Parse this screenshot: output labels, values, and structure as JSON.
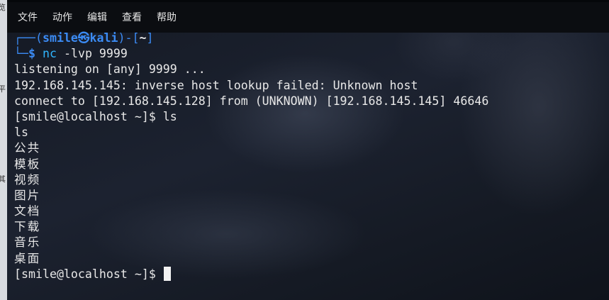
{
  "left_strip": {
    "chars": [
      "览",
      "平",
      "其"
    ]
  },
  "menu": [
    {
      "id": "file",
      "label": "文件"
    },
    {
      "id": "action",
      "label": "动作"
    },
    {
      "id": "edit",
      "label": "编辑"
    },
    {
      "id": "view",
      "label": "查看"
    },
    {
      "id": "help",
      "label": "帮助"
    }
  ],
  "prompt": {
    "corner_top": "┌──(",
    "user": "smile",
    "at_symbol": "㉿",
    "host": "kali",
    "close_paren": ")-[",
    "dir": "~",
    "close_bracket": "]",
    "corner_bottom": "└─",
    "dollar": "$",
    "command_name": "nc",
    "command_args": "-lvp 9999"
  },
  "output_lines": [
    "listening on [any] 9999 ...",
    "192.168.145.145: inverse host lookup failed: Unknown host",
    "connect to [192.168.145.128] from (UNKNOWN) [192.168.145.145] 46646",
    "[smile@localhost ~]$ ls",
    "ls"
  ],
  "ls_entries": [
    "公共",
    "模板",
    "视频",
    "图片",
    "文档",
    "下载",
    "音乐",
    "桌面"
  ],
  "remote_prompt": "[smile@localhost ~]$ "
}
